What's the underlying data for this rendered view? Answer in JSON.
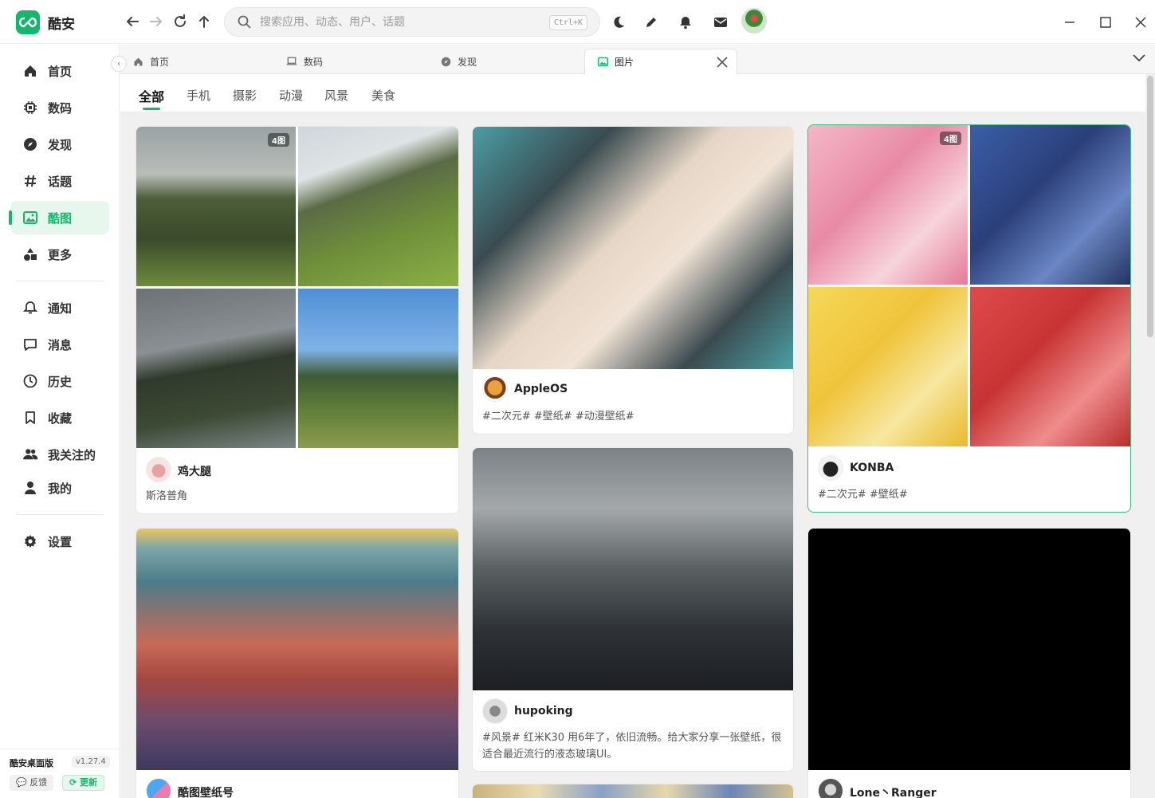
{
  "app": {
    "name": "酷安"
  },
  "search": {
    "placeholder": "搜索应用、动态、用户、话题",
    "shortcut": "Ctrl+K"
  },
  "sidebar": {
    "items": [
      {
        "label": "首页",
        "icon": "home-icon"
      },
      {
        "label": "数码",
        "icon": "chip-icon"
      },
      {
        "label": "发现",
        "icon": "compass-icon"
      },
      {
        "label": "话题",
        "icon": "hash-icon"
      },
      {
        "label": "酷图",
        "icon": "gallery-icon",
        "active": true
      },
      {
        "label": "更多",
        "icon": "shapes-icon"
      },
      {
        "label": "通知",
        "icon": "bell-icon"
      },
      {
        "label": "消息",
        "icon": "chat-icon"
      },
      {
        "label": "历史",
        "icon": "clock-icon"
      },
      {
        "label": "收藏",
        "icon": "bookmark-icon"
      },
      {
        "label": "我关注的",
        "icon": "users-icon"
      },
      {
        "label": "我的",
        "icon": "user-icon"
      },
      {
        "label": "设置",
        "icon": "gear-icon"
      }
    ],
    "footer": {
      "name": "酷安桌面版",
      "version": "v1.27.4",
      "feedback": "反馈",
      "update": "更新"
    }
  },
  "tabs": [
    {
      "label": "首页",
      "icon": "home-icon"
    },
    {
      "label": "数码",
      "icon": "laptop-icon"
    },
    {
      "label": "发现",
      "icon": "compass-icon"
    },
    {
      "label": "图片",
      "icon": "image-icon",
      "active": true
    }
  ],
  "categories": [
    "全部",
    "手机",
    "摄影",
    "动漫",
    "风景",
    "美食"
  ],
  "active_category": "全部",
  "posts": [
    {
      "user": "鸡大腿",
      "text": "斯洛普角",
      "badge": "4图"
    },
    {
      "user": "AppleOS",
      "text": "#二次元# #壁纸# #动漫壁纸#"
    },
    {
      "user": "KONBA",
      "text": "#二次元# #壁纸#",
      "badge": "4图"
    },
    {
      "user": "酷图壁纸号",
      "text": ""
    },
    {
      "user": "hupoking",
      "text": "#风景# 红米K30 用6年了，依旧流畅。给大家分享一张壁纸，很适合最近流行的液态玻璃UI。"
    },
    {
      "user": "Lone丶Ranger",
      "text": ""
    }
  ],
  "colors": {
    "accent": "#11b76a",
    "active_bg": "#e7f7ee"
  }
}
